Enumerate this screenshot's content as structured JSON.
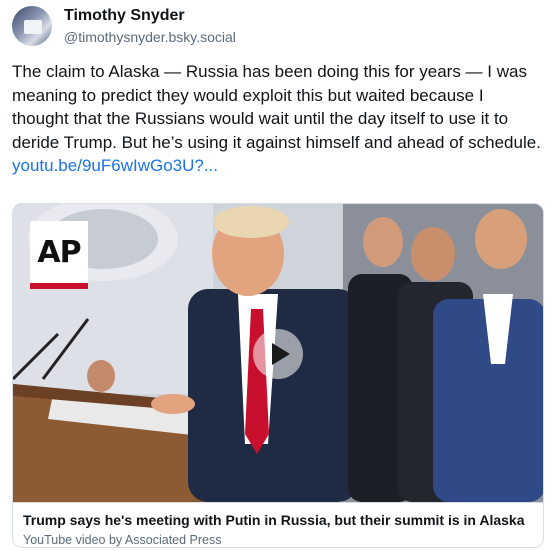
{
  "author": {
    "display_name": "Timothy Snyder",
    "handle": "@timothysnyder.bsky.social",
    "avatar_icon": "avatar-photo"
  },
  "post": {
    "text": "The claim to Alaska — Russia has been doing this for years — I was meaning to predict they would exploit this but waited because I thought that the Russians would wait until the day itself to use it to deride Trump. But he’s using it against himself and ahead of schedule.",
    "link_text": "youtu.be/9uF6wIwGo3U?..."
  },
  "embed": {
    "logo_text": "AP",
    "play_icon": "play-icon",
    "title": "Trump says he's meeting with Putin in Russia, but their summit is in Alaska",
    "subtitle": "YouTube video by Associated Press",
    "colors": {
      "ap_red": "#c8102e",
      "link": "#1a73e8"
    }
  }
}
